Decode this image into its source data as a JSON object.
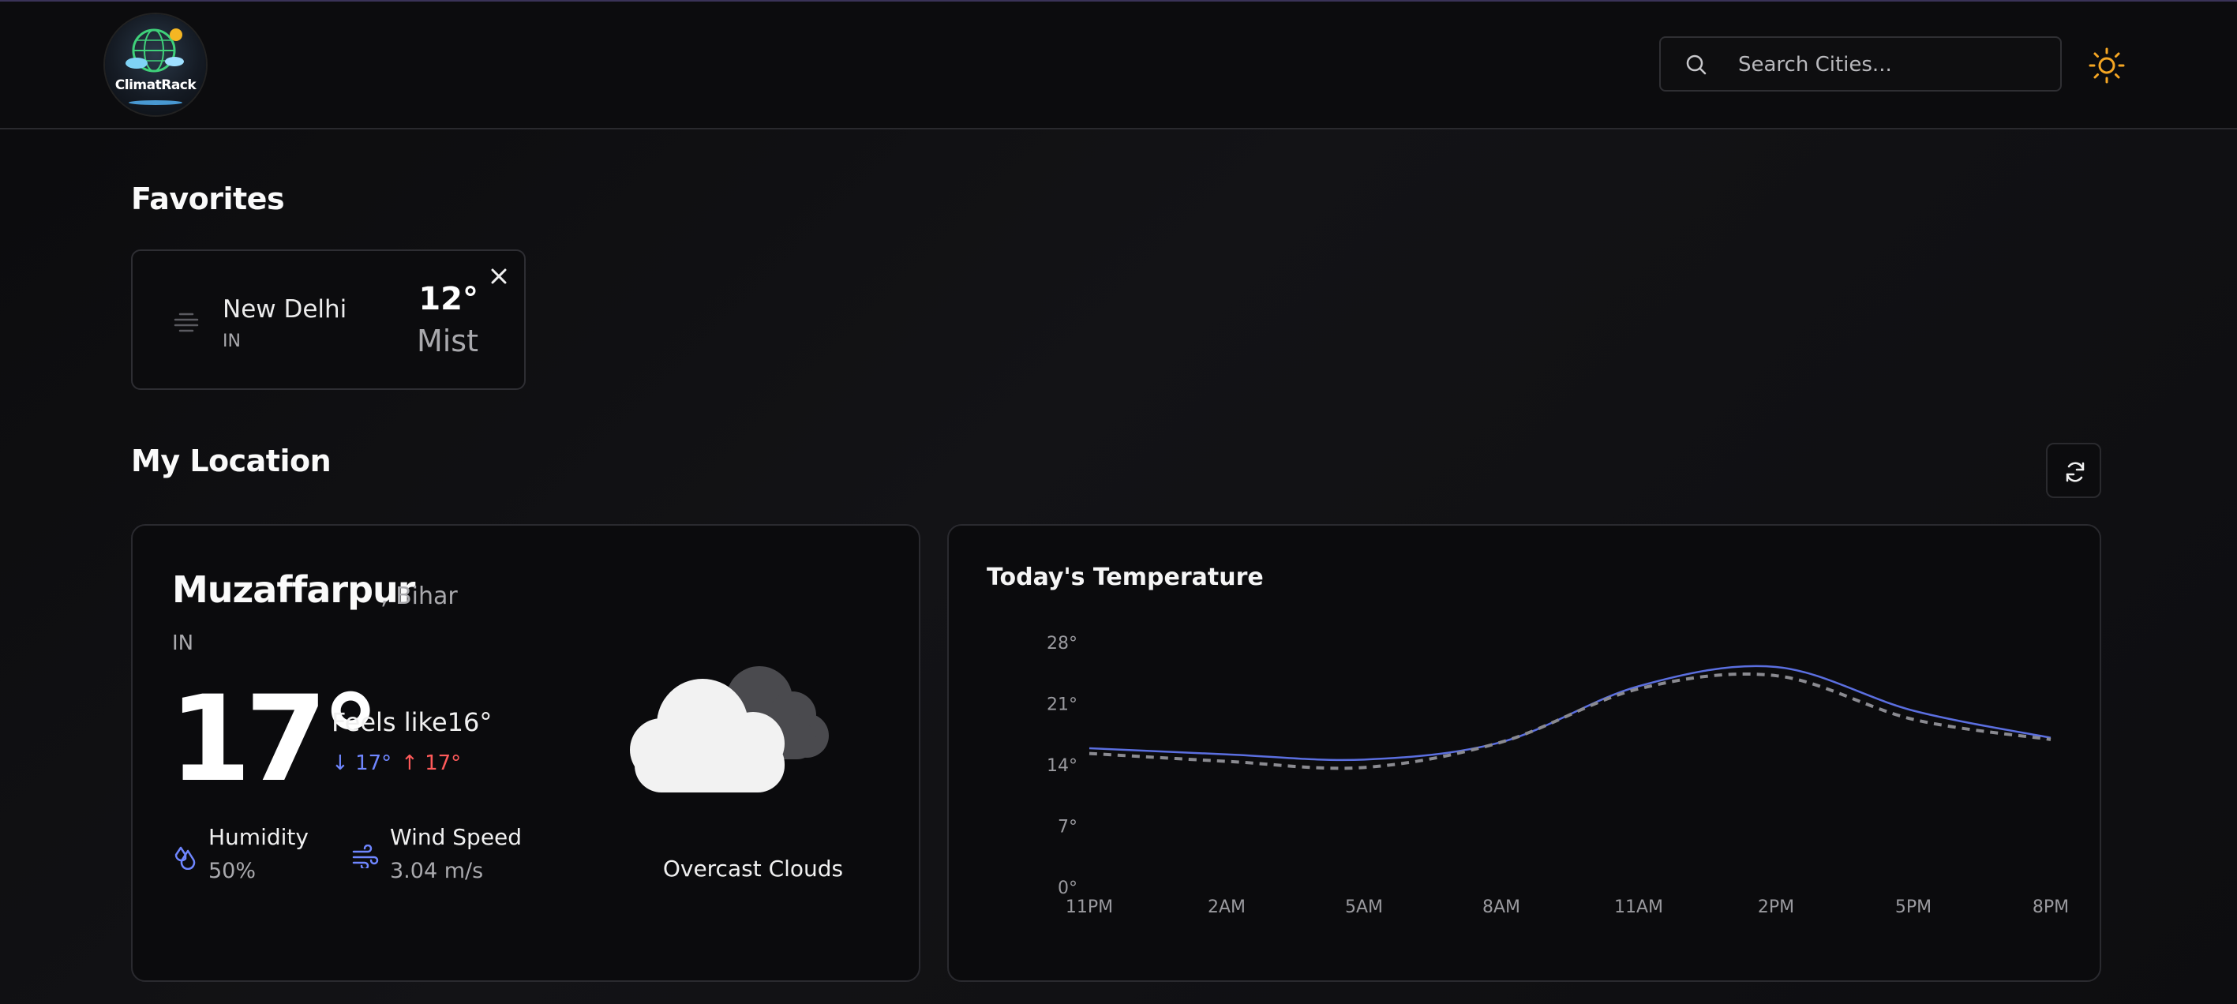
{
  "app": {
    "logo_text": "ClimatRack"
  },
  "search": {
    "placeholder": "Search Cities..."
  },
  "favorites": {
    "title": "Favorites",
    "items": [
      {
        "city": "New Delhi",
        "country": "IN",
        "temp": "12°",
        "description": "Mist",
        "icon": "mist-icon"
      }
    ]
  },
  "my_location": {
    "title": "My Location",
    "city": "Muzaffarpur",
    "region": ", Bihar",
    "country": "IN",
    "temp": "17°",
    "feels_like": "Feels like16°",
    "temp_min": "17°",
    "temp_max": "17°",
    "humidity_label": "Humidity",
    "humidity_value": "50%",
    "wind_label": "Wind Speed",
    "wind_value": "3.04 m/s",
    "condition": "Overcast Clouds",
    "condition_icon": "overcast-clouds-icon"
  },
  "colors": {
    "accent_blue": "#6f86ff",
    "accent_red": "#ff5a5a",
    "sun": "#f5a623",
    "temp_line": "#5b6fe0",
    "feels_line": "#8a8a90"
  },
  "chart_data": {
    "type": "line",
    "title": "Today's Temperature",
    "categories": [
      "11PM",
      "2AM",
      "5AM",
      "8AM",
      "11AM",
      "2PM",
      "5PM",
      "8PM"
    ],
    "y_ticks": [
      "0°",
      "7°",
      "14°",
      "21°",
      "28°"
    ],
    "ylim": [
      0,
      28
    ],
    "grid": false,
    "series": [
      {
        "values": [
          15.9,
          15.2,
          14.6,
          16.6,
          23.0,
          25.2,
          20.2,
          17.1
        ]
      },
      {
        "values": [
          15.3,
          14.4,
          13.7,
          16.6,
          22.7,
          24.2,
          19.2,
          16.9
        ]
      }
    ]
  }
}
